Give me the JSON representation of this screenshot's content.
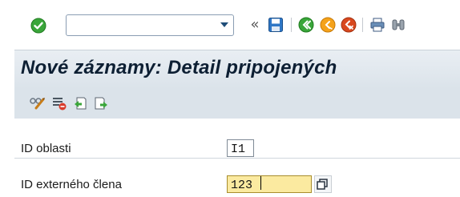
{
  "toolbar": {
    "command_field_value": "",
    "back_symbol": "«",
    "icons": [
      "check-icon",
      "save-icon",
      "back-icon",
      "exit-icon",
      "cancel-icon",
      "print-icon",
      "find-icon"
    ]
  },
  "title": "Nové záznamy: Detail pripojených",
  "app_toolbar": {
    "icons": [
      "display-change-icon",
      "delete-icon",
      "previous-entry-icon",
      "next-entry-icon"
    ]
  },
  "form": {
    "fields": [
      {
        "label": "ID oblasti",
        "value": "I1"
      },
      {
        "label": "ID externého člena",
        "value": "123"
      }
    ]
  },
  "colors": {
    "accent_green": "#3aa63a",
    "accent_orange": "#f5a21a",
    "accent_red": "#d9481e",
    "nav_blue": "#1f4e79",
    "focus_field": "#fbeaa0"
  }
}
